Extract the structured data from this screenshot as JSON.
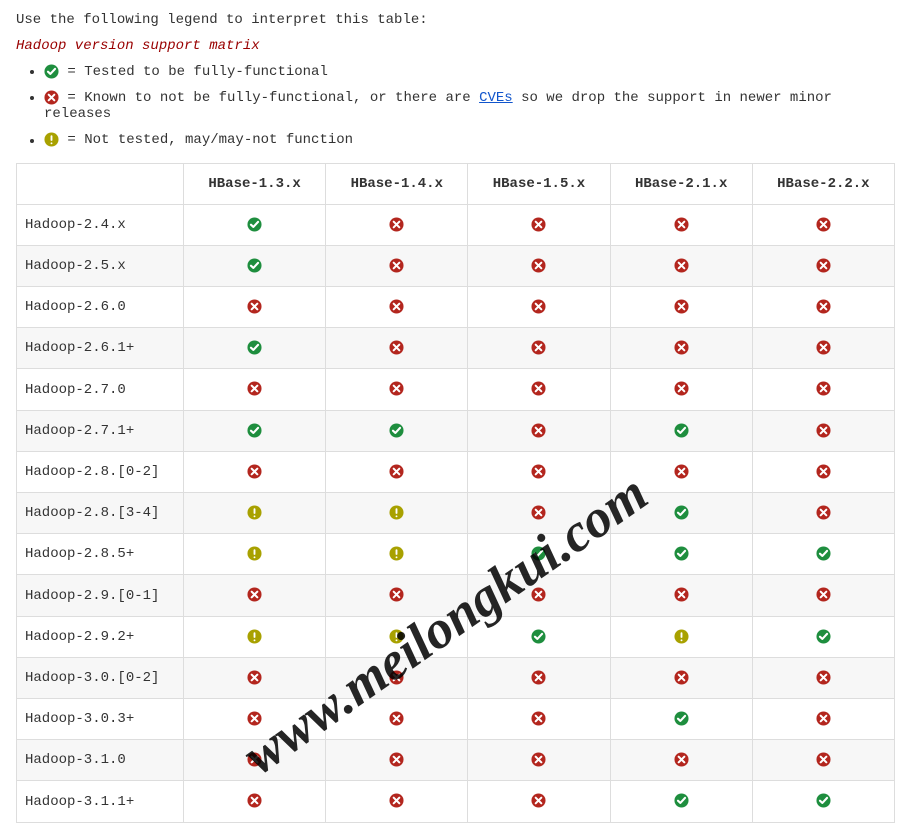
{
  "intro": "Use the following legend to interpret this table:",
  "matrix_title": "Hadoop version support matrix",
  "legend": {
    "ok": " = Tested to be fully-functional",
    "bad_prefix": " = Known to not be fully-functional, or there are ",
    "bad_link": "CVEs",
    "bad_suffix": " so we drop the support in newer minor releases",
    "warn": " = Not tested, may/may-not function"
  },
  "columns": [
    "HBase-1.3.x",
    "HBase-1.4.x",
    "HBase-1.5.x",
    "HBase-2.1.x",
    "HBase-2.2.x"
  ],
  "rows": [
    {
      "label": "Hadoop-2.4.x",
      "cells": [
        "ok",
        "bad",
        "bad",
        "bad",
        "bad"
      ]
    },
    {
      "label": "Hadoop-2.5.x",
      "cells": [
        "ok",
        "bad",
        "bad",
        "bad",
        "bad"
      ]
    },
    {
      "label": "Hadoop-2.6.0",
      "cells": [
        "bad",
        "bad",
        "bad",
        "bad",
        "bad"
      ]
    },
    {
      "label": "Hadoop-2.6.1+",
      "cells": [
        "ok",
        "bad",
        "bad",
        "bad",
        "bad"
      ]
    },
    {
      "label": "Hadoop-2.7.0",
      "cells": [
        "bad",
        "bad",
        "bad",
        "bad",
        "bad"
      ]
    },
    {
      "label": "Hadoop-2.7.1+",
      "cells": [
        "ok",
        "ok",
        "bad",
        "ok",
        "bad"
      ]
    },
    {
      "label": "Hadoop-2.8.[0-2]",
      "cells": [
        "bad",
        "bad",
        "bad",
        "bad",
        "bad"
      ]
    },
    {
      "label": "Hadoop-2.8.[3-4]",
      "cells": [
        "warn",
        "warn",
        "bad",
        "ok",
        "bad"
      ]
    },
    {
      "label": "Hadoop-2.8.5+",
      "cells": [
        "warn",
        "warn",
        "ok",
        "ok",
        "ok"
      ]
    },
    {
      "label": "Hadoop-2.9.[0-1]",
      "cells": [
        "bad",
        "bad",
        "bad",
        "bad",
        "bad"
      ]
    },
    {
      "label": "Hadoop-2.9.2+",
      "cells": [
        "warn",
        "warn",
        "ok",
        "warn",
        "ok"
      ]
    },
    {
      "label": "Hadoop-3.0.[0-2]",
      "cells": [
        "bad",
        "bad",
        "bad",
        "bad",
        "bad"
      ]
    },
    {
      "label": "Hadoop-3.0.3+",
      "cells": [
        "bad",
        "bad",
        "bad",
        "ok",
        "bad"
      ]
    },
    {
      "label": "Hadoop-3.1.0",
      "cells": [
        "bad",
        "bad",
        "bad",
        "bad",
        "bad"
      ]
    },
    {
      "label": "Hadoop-3.1.1+",
      "cells": [
        "bad",
        "bad",
        "bad",
        "ok",
        "ok"
      ]
    }
  ],
  "watermark": "www.meilongkui.com",
  "colors": {
    "ok": "#1e8e3e",
    "bad": "#b3261e",
    "warn": "#a8a100"
  }
}
